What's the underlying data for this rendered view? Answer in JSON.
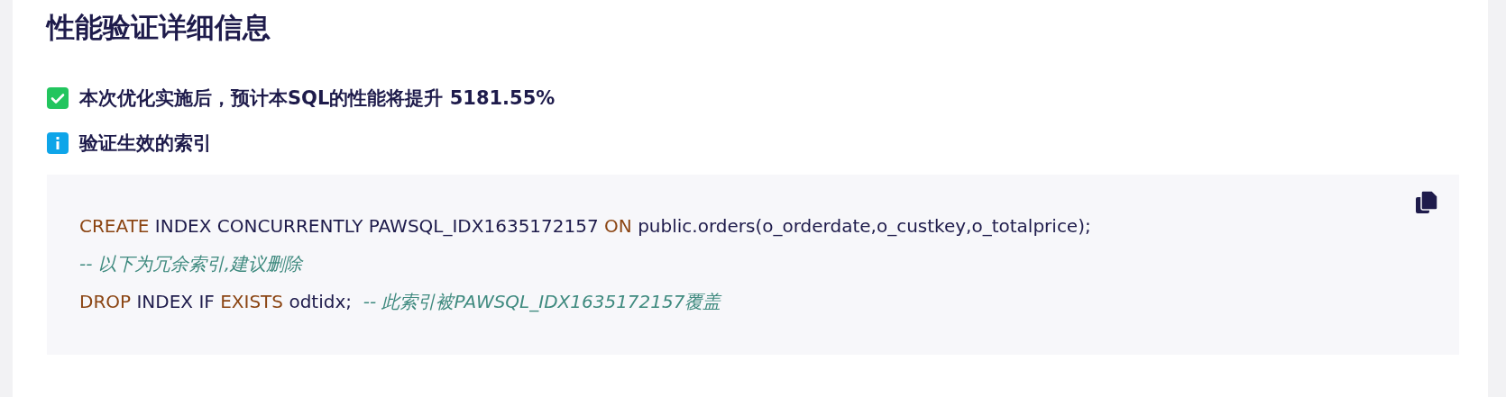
{
  "title": "性能验证详细信息",
  "notices": [
    {
      "kind": "success",
      "text": "本次优化实施后，预计本SQL的性能将提升 5181.55%"
    },
    {
      "kind": "info",
      "text": "验证生效的索引"
    }
  ],
  "code_block": {
    "lines": [
      [
        {
          "kind": "keyword",
          "text": "CREATE"
        },
        {
          "kind": "plain",
          "text": " INDEX CONCURRENTLY PAWSQL_IDX1635172157 "
        },
        {
          "kind": "keyword",
          "text": "ON"
        },
        {
          "kind": "plain",
          "text": " public.orders(o_orderdate,o_custkey,o_totalprice);"
        }
      ],
      [
        {
          "kind": "comment",
          "text": "-- 以下为冗余索引,建议删除"
        }
      ],
      [
        {
          "kind": "keyword",
          "text": "DROP"
        },
        {
          "kind": "plain",
          "text": " INDEX IF "
        },
        {
          "kind": "keyword",
          "text": "EXISTS"
        },
        {
          "kind": "plain",
          "text": " odtidx;  "
        },
        {
          "kind": "comment",
          "text": "-- 此索引被PAWSQL_IDX1635172157覆盖"
        }
      ]
    ]
  }
}
